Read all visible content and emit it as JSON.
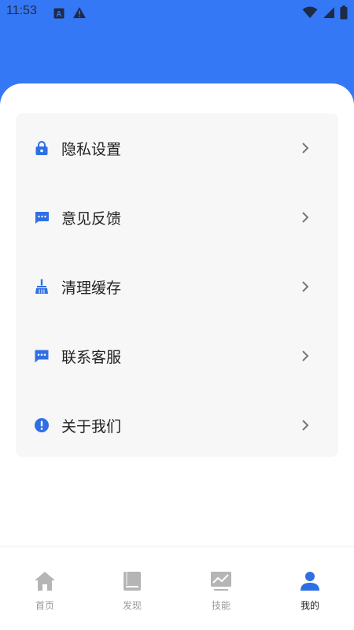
{
  "status_bar": {
    "time": "11:53",
    "left_icons": [
      "font-a-icon",
      "warning-icon"
    ],
    "right_icons": [
      "wifi-icon",
      "signal-icon",
      "battery-icon"
    ]
  },
  "colors": {
    "accent": "#3578f6",
    "menu_icon": "#2f6fe4",
    "card_bg": "#f7f7f8",
    "tab_active": "#2f6fe4",
    "tab_inactive": "#b5b5b5"
  },
  "menu": {
    "items": [
      {
        "label": "隐私设置",
        "icon": "lock-icon"
      },
      {
        "label": "意见反馈",
        "icon": "feedback-bubble-icon"
      },
      {
        "label": "清理缓存",
        "icon": "broom-icon"
      },
      {
        "label": "联系客服",
        "icon": "chat-bubble-icon"
      },
      {
        "label": "关于我们",
        "icon": "info-exclamation-icon"
      }
    ]
  },
  "tabs": [
    {
      "label": "首页",
      "icon": "home-icon",
      "active": false
    },
    {
      "label": "发现",
      "icon": "book-icon",
      "active": false
    },
    {
      "label": "技能",
      "icon": "chart-icon",
      "active": false
    },
    {
      "label": "我的",
      "icon": "person-icon",
      "active": true
    }
  ]
}
